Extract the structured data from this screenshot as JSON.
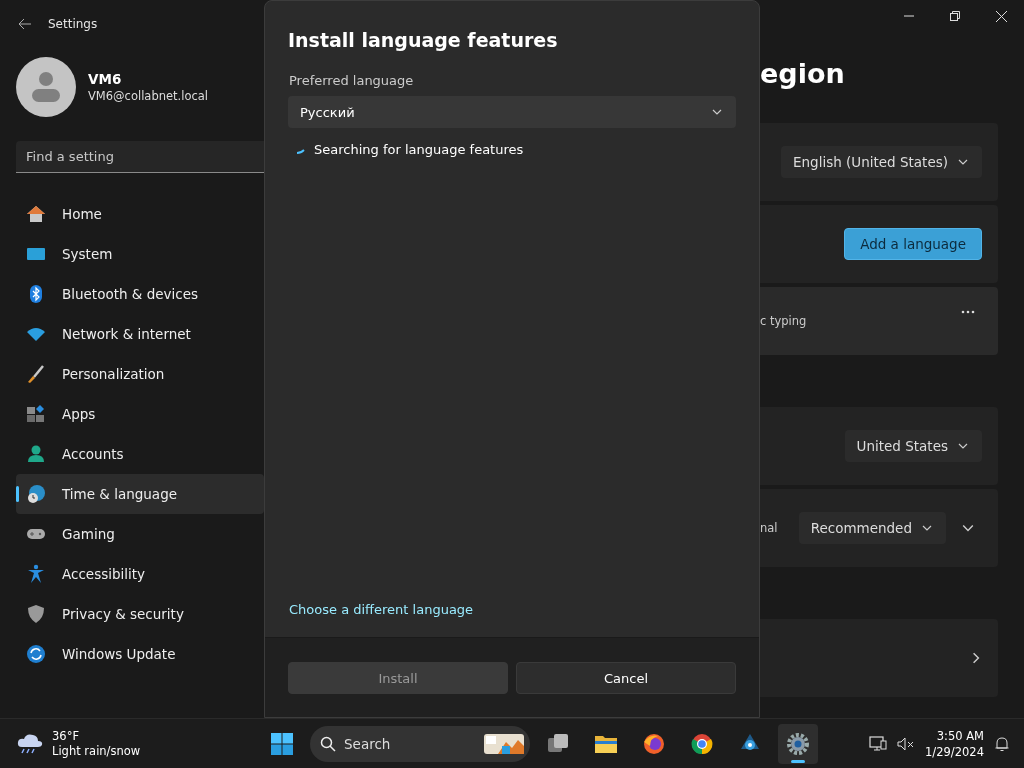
{
  "window": {
    "title": "Settings"
  },
  "profile": {
    "name": "VM6",
    "email": "VM6@collabnet.local"
  },
  "search": {
    "placeholder": "Find a setting"
  },
  "nav": [
    {
      "label": "Home",
      "kind": "home",
      "selected": false
    },
    {
      "label": "System",
      "kind": "system",
      "selected": false
    },
    {
      "label": "Bluetooth & devices",
      "kind": "bluetooth",
      "selected": false
    },
    {
      "label": "Network & internet",
      "kind": "network",
      "selected": false
    },
    {
      "label": "Personalization",
      "kind": "brush",
      "selected": false
    },
    {
      "label": "Apps",
      "kind": "apps",
      "selected": false
    },
    {
      "label": "Accounts",
      "kind": "accounts",
      "selected": false
    },
    {
      "label": "Time & language",
      "kind": "time",
      "selected": true
    },
    {
      "label": "Gaming",
      "kind": "gaming",
      "selected": false
    },
    {
      "label": "Accessibility",
      "kind": "accessibility",
      "selected": false
    },
    {
      "label": "Privacy & security",
      "kind": "shield",
      "selected": false
    },
    {
      "label": "Windows Update",
      "kind": "update",
      "selected": false
    }
  ],
  "page": {
    "title": "egion",
    "sections": [
      {
        "cards": [
          {
            "kind": "dropdown",
            "value": "English (United States)"
          },
          {
            "kind": "button",
            "label": "Add a language"
          },
          {
            "kind": "language",
            "text": "c typing"
          }
        ]
      },
      {
        "cards": [
          {
            "kind": "dropdown",
            "value": "United States"
          },
          {
            "kind": "dropdown",
            "text": "nal",
            "value": "Recommended",
            "expanded": false
          }
        ]
      },
      {
        "cards": [
          {
            "kind": "link"
          }
        ]
      }
    ]
  },
  "dialog": {
    "title": "Install language features",
    "label": "Preferred language",
    "dropdown": {
      "value": "Русский"
    },
    "status": "Searching for language features",
    "link": "Choose a different language",
    "buttons": [
      {
        "label": "Install",
        "disabled": true
      },
      {
        "label": "Cancel",
        "disabled": false
      }
    ]
  },
  "taskbar": {
    "weather": {
      "temp": "36°F",
      "condition": "Light rain/snow"
    },
    "search": {
      "placeholder": "Search"
    },
    "apps": [
      {
        "kind": "taskview",
        "selected": false
      },
      {
        "kind": "explorer",
        "selected": false
      },
      {
        "kind": "firefox",
        "selected": false
      },
      {
        "kind": "chrome",
        "selected": false
      },
      {
        "kind": "app",
        "selected": false
      },
      {
        "kind": "settings",
        "selected": true
      }
    ],
    "time": "3:50 AM",
    "date": "1/29/2024"
  }
}
